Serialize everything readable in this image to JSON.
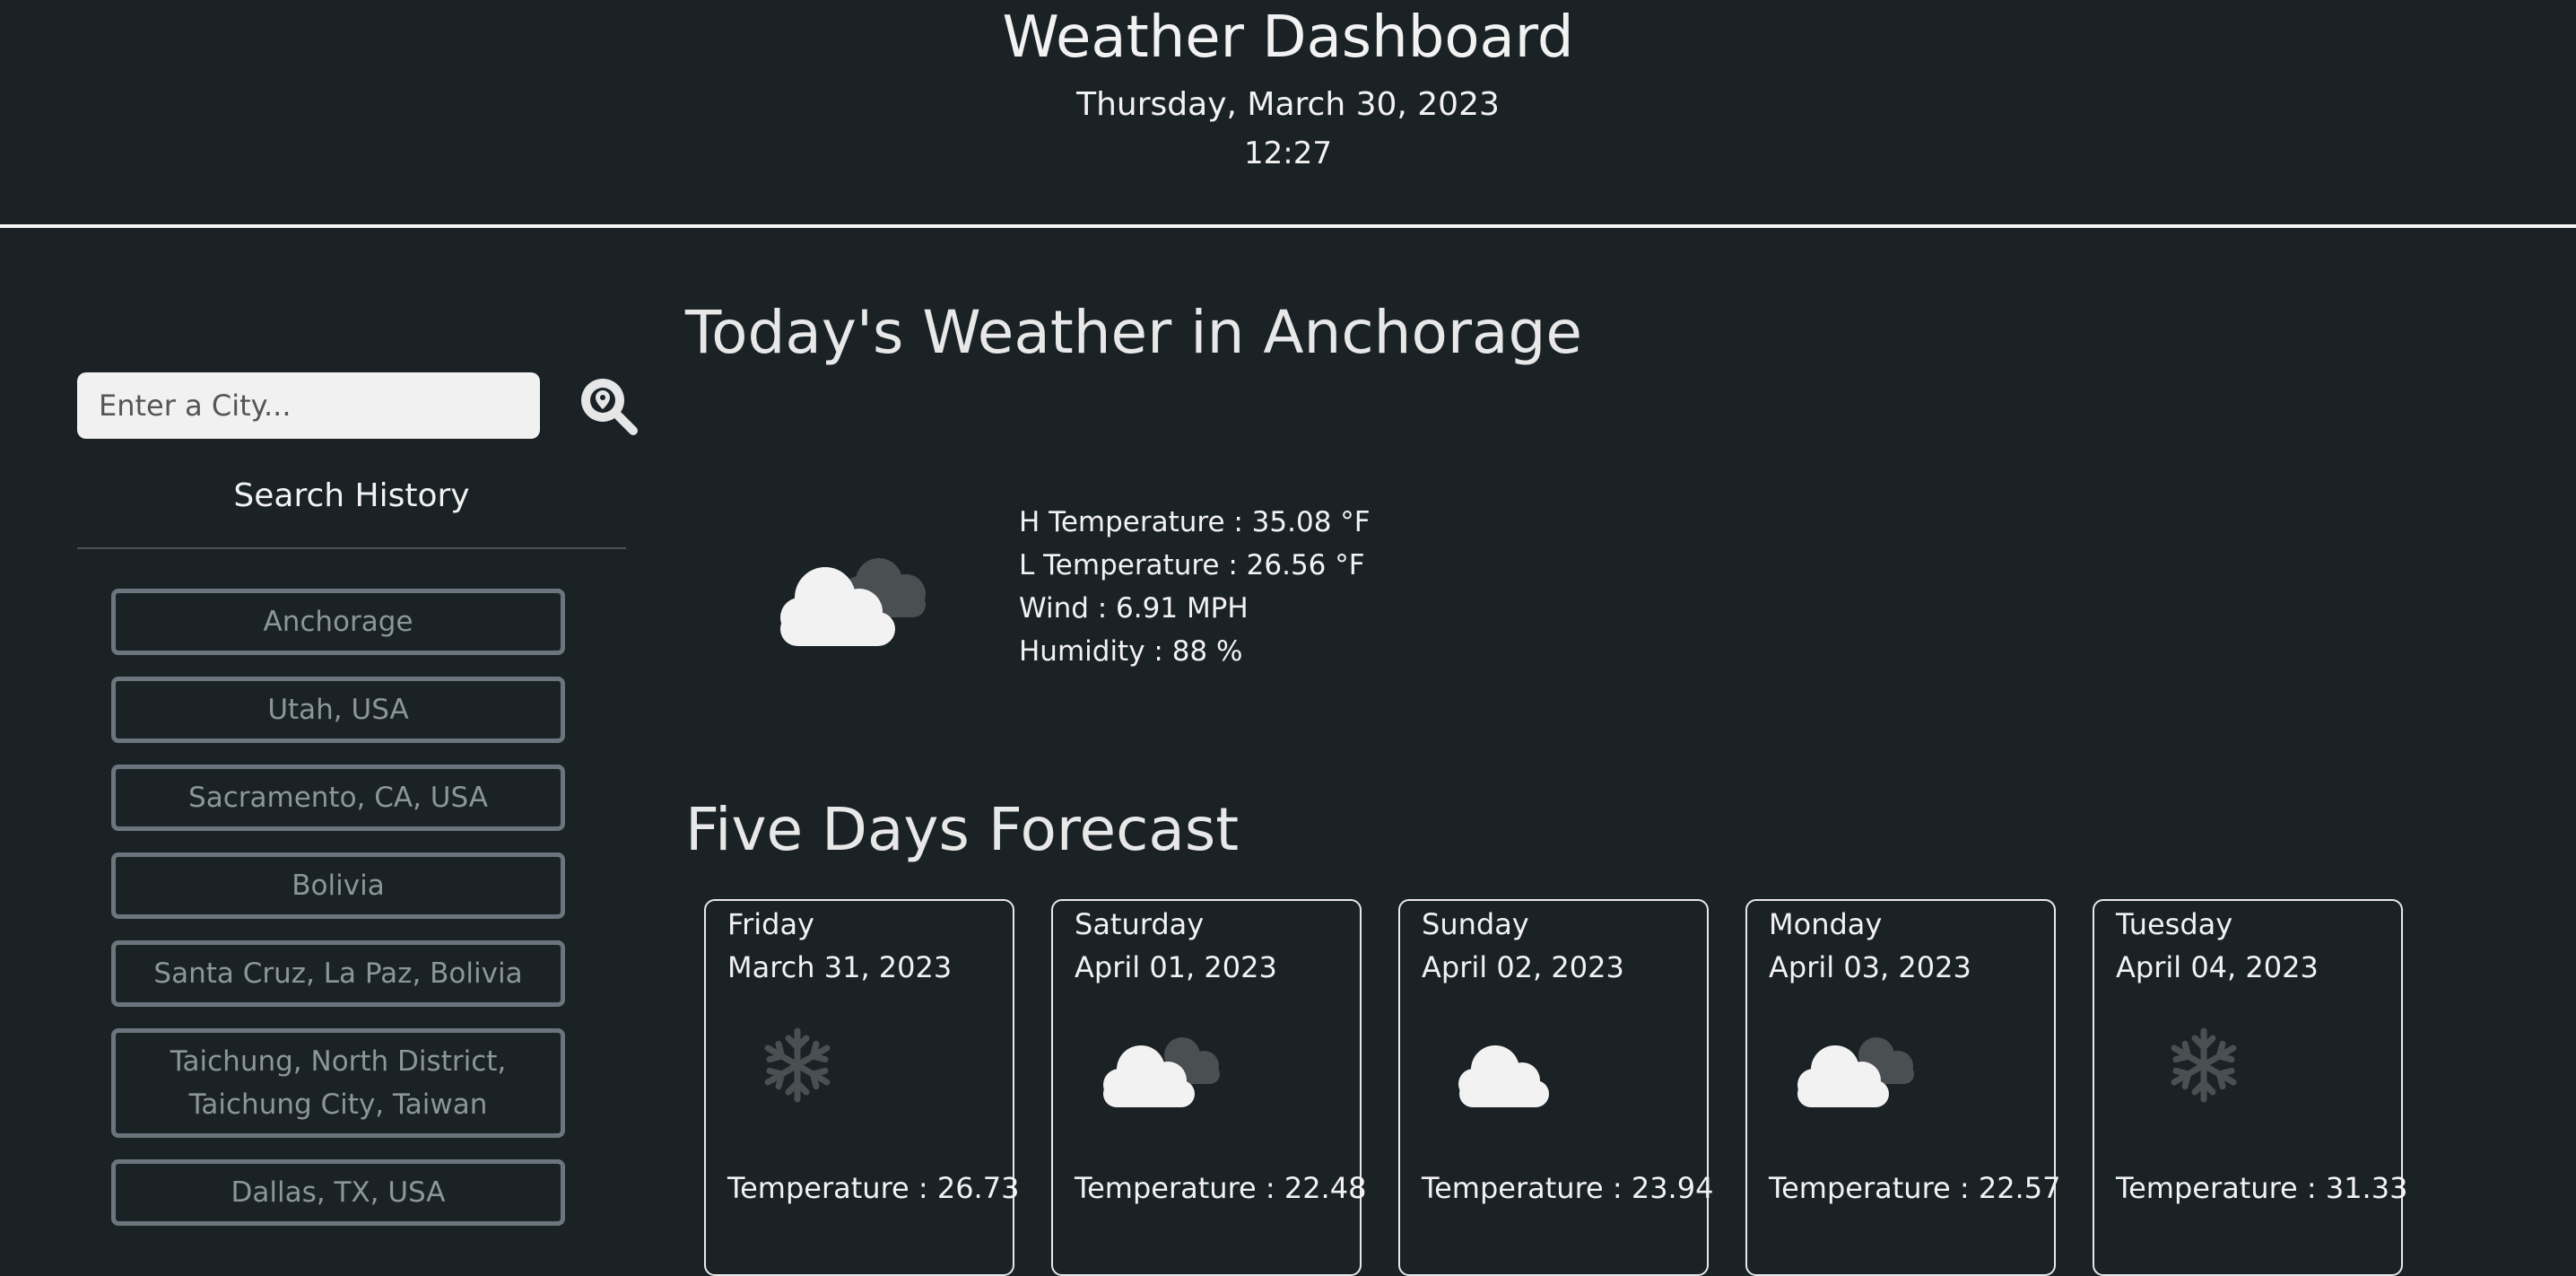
{
  "header": {
    "title": "Weather Dashboard",
    "date": "Thursday, March 30, 2023",
    "time": "12:27"
  },
  "search": {
    "placeholder": "Enter a City...",
    "button_icon": "map-marker-search-icon"
  },
  "history": {
    "title": "Search History",
    "items": [
      "Anchorage",
      "Utah, USA",
      "Sacramento, CA, USA",
      "Bolivia",
      "Santa Cruz, La Paz, Bolivia",
      "Taichung, North District, Taichung City, Taiwan",
      "Dallas, TX, USA"
    ]
  },
  "today": {
    "title": "Today's Weather in Anchorage",
    "icon": "cloudy-icon",
    "high": "H Temperature : 35.08 °F",
    "low": "L Temperature : 26.56 °F",
    "wind": "Wind : 6.91 MPH",
    "humidity": "Humidity : 88 %"
  },
  "forecast": {
    "title": "Five Days Forecast",
    "days": [
      {
        "day": "Friday",
        "date": "March 31, 2023",
        "icon": "snowflake-icon",
        "temp": "Temperature : 26.73"
      },
      {
        "day": "Saturday",
        "date": "April 01, 2023",
        "icon": "cloudy-icon",
        "temp": "Temperature : 22.48"
      },
      {
        "day": "Sunday",
        "date": "April 02, 2023",
        "icon": "cloud-icon",
        "temp": "Temperature : 23.94"
      },
      {
        "day": "Monday",
        "date": "April 03, 2023",
        "icon": "cloudy-icon",
        "temp": "Temperature : 22.57"
      },
      {
        "day": "Tuesday",
        "date": "April 04, 2023",
        "icon": "snowflake-icon",
        "temp": "Temperature : 31.33"
      }
    ]
  },
  "colors": {
    "background": "#1b2226",
    "text": "#f2f2f2",
    "history_border": "#6c757d",
    "history_text": "#8d959c"
  }
}
